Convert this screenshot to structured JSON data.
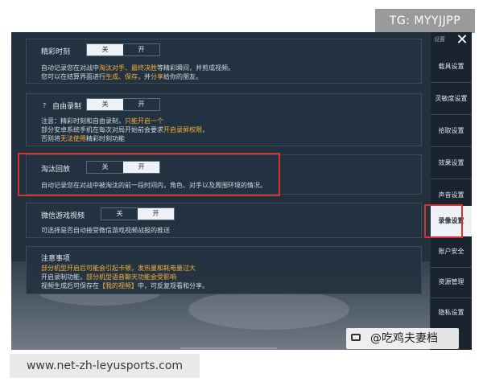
{
  "watermarks": {
    "tg": "TG: MYYJJPP",
    "url": "www.net-zh-leyusports.com",
    "author": "@吃鸡夫妻档"
  },
  "top_left_label": "设置",
  "close_label": "✕",
  "sections": [
    {
      "title": "精彩时刻",
      "off_label": "关",
      "on_label": "开",
      "selected": "off",
      "desc": [
        [
          "自动记录您在对战中",
          "淘汰对手、最终决胜",
          "等精彩瞬间，并剪成视频。"
        ],
        [
          "您可以在结算界面进行",
          "生成、保存",
          "，并",
          "分享",
          "给你的朋友。"
        ]
      ]
    },
    {
      "title": "自由录制",
      "qmark": "?",
      "off_label": "关",
      "on_label": "开",
      "selected": "off",
      "desc": [
        [
          "注意：精彩时刻和自由录制，",
          "只能开启一个"
        ],
        [
          "部分安卓系统手机在每次对局开始前会要求",
          "开启录屏权限",
          "，"
        ],
        [
          "否则将",
          "无法使用",
          "精彩时刻功能"
        ]
      ]
    },
    {
      "title": "淘汰回放",
      "off_label": "关",
      "on_label": "开",
      "selected": "on",
      "desc": [
        [
          "自动记录您在对战中被淘汰的前一段时间内，角色、对手以及周围环境的情况。"
        ]
      ]
    },
    {
      "title": "微信游戏视频",
      "off_label": "关",
      "on_label": "开",
      "selected": "on",
      "desc": [
        [
          "可选择是否自动接受微信游戏视频战报的推送"
        ]
      ]
    },
    {
      "title": "注意事项",
      "desc": [
        [
          "部分机型开启后可能会引起卡顿，发热量和耗电量过大"
        ],
        [
          "开启录制功能，",
          "部分机型语音聊天功能会受影响"
        ],
        [
          "视频生成后可保存在",
          "【我的视频】",
          "中，可反复观看和分享。"
        ]
      ]
    }
  ],
  "sidebar": {
    "items": [
      {
        "label": "载具设置",
        "active": false
      },
      {
        "label": "灵敏度设置",
        "active": false
      },
      {
        "label": "拾取设置",
        "active": false
      },
      {
        "label": "效果设置",
        "active": false
      },
      {
        "label": "声音设置",
        "active": false
      },
      {
        "label": "录像设置",
        "active": true
      },
      {
        "label": "账户安全",
        "active": false
      },
      {
        "label": "资源管理",
        "active": false
      },
      {
        "label": "隐私设置",
        "active": false
      }
    ]
  },
  "colors": {
    "highlight": "#f2b13c",
    "annotation_red": "#d7332e",
    "panel_bg": "#243240"
  }
}
